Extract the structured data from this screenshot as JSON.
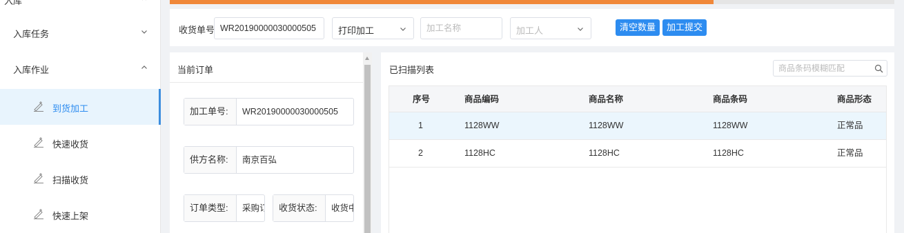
{
  "sidebar": {
    "top_label": "入库",
    "groups": [
      {
        "label": "入库任务"
      },
      {
        "label": "入库作业"
      }
    ],
    "items": [
      {
        "label": "到货加工",
        "active": true
      },
      {
        "label": "快速收货"
      },
      {
        "label": "扫描收货"
      },
      {
        "label": "快速上架"
      }
    ]
  },
  "progress": {
    "percent": 75,
    "color": "#f0883a"
  },
  "toolbar": {
    "receipt_label": "收货单号",
    "receipt_value": "WR20190000030000505",
    "print_select": "打印加工",
    "process_name_placeholder": "加工名称",
    "processor_placeholder": "加工人",
    "clear_button": "清空数量",
    "submit_button": "加工提交"
  },
  "order": {
    "title": "当前订单",
    "fields": [
      {
        "label": "加工单号:",
        "value": "WR20190000030000505"
      },
      {
        "label": "供方名称:",
        "value": "南京百弘"
      },
      {
        "label": "订单类型:",
        "value": "采购订单"
      },
      {
        "label": "收货状态:",
        "value": "收货中"
      }
    ]
  },
  "scanned": {
    "title": "已扫描列表",
    "search_placeholder": "商品条码模糊匹配",
    "columns": [
      "序号",
      "商品编码",
      "商品名称",
      "商品条码",
      "商品形态"
    ],
    "rows": [
      [
        "1",
        "1128WW",
        "1128WW",
        "1128WW",
        "正常品"
      ],
      [
        "2",
        "1128HC",
        "1128HC",
        "1128HC",
        "正常品"
      ]
    ]
  },
  "colors": {
    "accent": "#2d8cf0",
    "progress": "#f0883a",
    "highlight_row": "#ebf6fd"
  }
}
